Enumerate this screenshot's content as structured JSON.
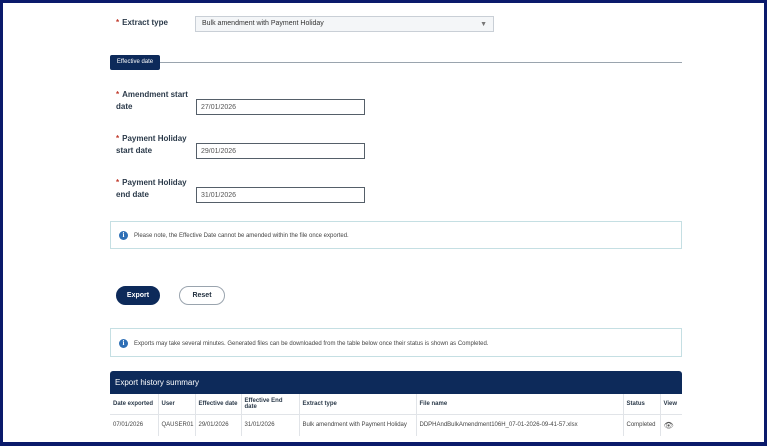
{
  "form": {
    "required_marker": "*",
    "extract_type": {
      "label": "Extract type",
      "value": "Bulk amendment with Payment Holiday"
    },
    "section": {
      "label": "Effective date"
    },
    "amendment_start": {
      "label_line1": "Amendment start",
      "label_line2": "date",
      "value": "27/01/2026"
    },
    "holiday_start": {
      "label_line1": "Payment Holiday",
      "label_line2": "start date",
      "value": "29/01/2026"
    },
    "holiday_end": {
      "label_line1": "Payment Holiday",
      "label_line2": "end date",
      "value": "31/01/2026"
    },
    "note": "Please note, the Effective Date cannot be amended within the file once exported."
  },
  "actions": {
    "export_label": "Export",
    "reset_label": "Reset"
  },
  "exports_info": "Exports may take several minutes. Generated files can be downloaded from the table below once their status is shown as Completed.",
  "history": {
    "title": "Export history summary",
    "columns": [
      "Date exported",
      "User",
      "Effective date",
      "Effective End date",
      "Extract type",
      "File name",
      "Status",
      "View"
    ],
    "rows": [
      {
        "date_exported": "07/01/2026",
        "user": "QAUSER01",
        "effective_date": "29/01/2026",
        "effective_end_date": "31/01/2026",
        "extract_type": "Bulk amendment with Payment Holiday",
        "file_name": "DDPHAndBulkAmendment106H_07-01-2026-09-41-57.xlsx",
        "status": "Completed",
        "view_icon": "eye-icon"
      }
    ]
  },
  "colors": {
    "primary": "#0d2a5a",
    "required": "#c0392b",
    "info_icon": "#2e6fb5",
    "frame_border": "#0a1a6b"
  }
}
